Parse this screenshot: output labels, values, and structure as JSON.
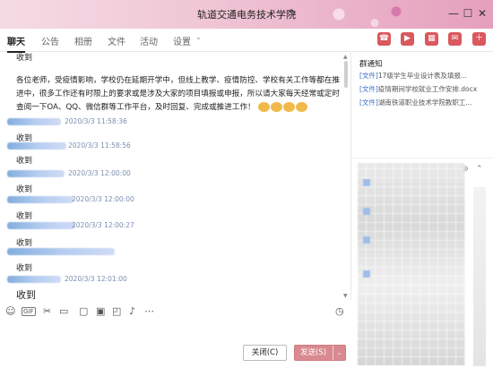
{
  "window": {
    "title": "轨道交通电务技术学院",
    "controls": {
      "minimize": "—",
      "maximize": "☐",
      "close": "✕"
    }
  },
  "tabs": [
    {
      "label": "聊天"
    },
    {
      "label": "公告"
    },
    {
      "label": "相册"
    },
    {
      "label": "文件"
    },
    {
      "label": "活动"
    },
    {
      "label": "设置"
    }
  ],
  "toolbar_icons": [
    "phone-icon",
    "video-icon",
    "screen-share-icon",
    "message-icon",
    "add-icon"
  ],
  "chat": {
    "top_partial": "收到",
    "announcement": "各位老师，受疫情影响，学校仍在延期开学中，但线上教学、疫情防控、学校有关工作等都在推进中，很多工作还有时限上的要求或是涉及大家的项目填报或申报，所以请大家每天经常或定时查阅一下OA、QQ、微信群等工作平台，及时回复、完成或推进工作！",
    "messages": [
      {
        "time": "2020/3/3 11:58:36",
        "text": "收到"
      },
      {
        "time": "2020/3/3 11:58:56",
        "text": "收到"
      },
      {
        "time": "2020/3/3 12:00:00",
        "text": "收到"
      },
      {
        "time": "2020/3/3 12:00:00",
        "text": "收到"
      },
      {
        "time": "2020/3/3 12:00:27",
        "text": "收到"
      },
      {
        "time": "",
        "text": "收到"
      },
      {
        "time": "2020/3/3 12:01:00",
        "text": "收到"
      }
    ]
  },
  "buttons": {
    "close": "关闭(C)",
    "send": "发送(S)"
  },
  "group_notice": {
    "title": "群通知",
    "files": [
      {
        "tag": "[文件]",
        "name": "17级学生毕业设计表及填报..."
      },
      {
        "tag": "[文件]",
        "name": "疫情期间学校就业工作安排.docx"
      },
      {
        "tag": "[文件]",
        "name": "湖南铁道职业技术学院教职工..."
      }
    ]
  }
}
